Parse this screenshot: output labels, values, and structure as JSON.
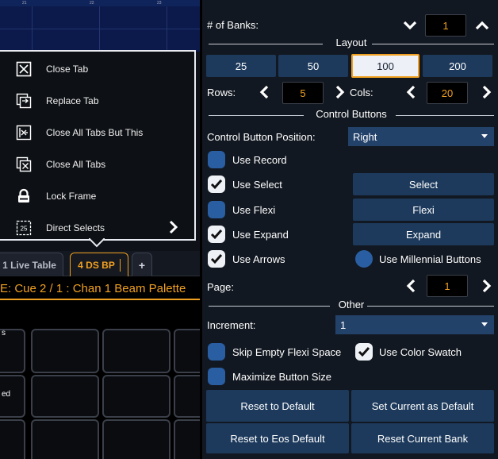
{
  "background": {
    "ruler_marks": [
      "21",
      "22",
      "23"
    ],
    "tabs": [
      {
        "label": "1 Live Table"
      },
      {
        "label": "4 DS  BP"
      },
      {
        "label": "+"
      }
    ],
    "cue_text": "E: Cue  2 / 1 :  Chan 1 Beam Palette",
    "cell_labels": [
      "s",
      "ed"
    ]
  },
  "context_menu": {
    "items": [
      {
        "label": "Close Tab",
        "icon": "close-box-icon"
      },
      {
        "label": "Replace Tab",
        "icon": "replace-tab-icon"
      },
      {
        "label": "Close All Tabs But This",
        "icon": "close-all-but-icon"
      },
      {
        "label": "Close All Tabs",
        "icon": "close-all-icon"
      },
      {
        "label": "Lock Frame",
        "icon": "lock-icon"
      },
      {
        "label": "Direct Selects",
        "icon": "direct-selects-icon",
        "badge": "25"
      }
    ]
  },
  "panel": {
    "banks": {
      "label": "# of Banks:",
      "value": "1"
    },
    "layout": {
      "title": "Layout",
      "sizes": [
        "25",
        "50",
        "100",
        "200"
      ],
      "selected": "100",
      "rows_label": "Rows:",
      "rows": "5",
      "cols_label": "Cols:",
      "cols": "20"
    },
    "control_buttons": {
      "title": "Control Buttons",
      "position_label": "Control Button Position:",
      "position_value": "Right",
      "use_record": "Use Record",
      "use_select": "Use Select",
      "use_flexi": "Use Flexi",
      "use_expand": "Use Expand",
      "use_arrows": "Use Arrows",
      "use_millennial": "Use Millennial Buttons",
      "select_btn": "Select",
      "flexi_btn": "Flexi",
      "expand_btn": "Expand",
      "page_label": "Page:",
      "page_value": "1"
    },
    "other": {
      "title": "Other",
      "increment_label": "Increment:",
      "increment_value": "1",
      "skip_empty": "Skip Empty Flexi Space",
      "use_color_swatch": "Use Color Swatch",
      "maximize": "Maximize Button Size"
    },
    "actions": {
      "reset_default": "Reset to Default",
      "set_current_default": "Set Current as Default",
      "reset_eos": "Reset to Eos Default",
      "reset_bank": "Reset Current Bank"
    }
  },
  "colors": {
    "accent": "#f0a020",
    "button_blue": "#1d3a5c",
    "panel_bg": "#121821"
  }
}
